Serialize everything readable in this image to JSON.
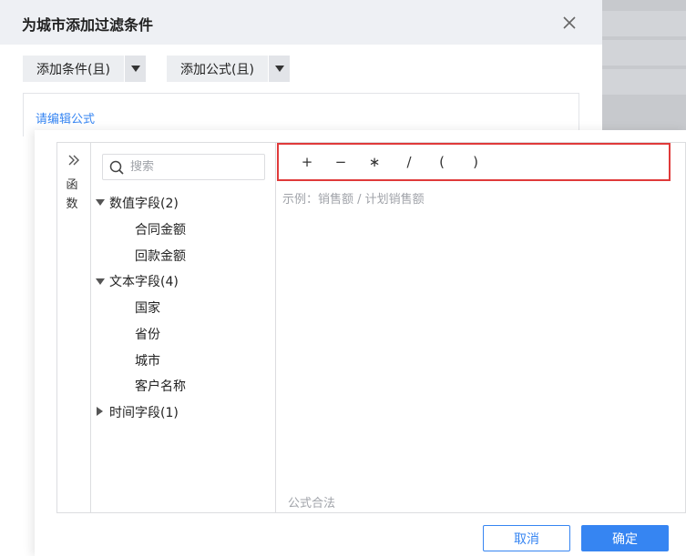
{
  "dialog": {
    "title": "为城市添加过滤条件",
    "add_condition_label": "添加条件(且)",
    "add_formula_label": "添加公式(且)",
    "formula_placeholder": "请编辑公式"
  },
  "editor": {
    "function_tab_label": "函\n数",
    "search_placeholder": "搜索",
    "tree": [
      {
        "label": "数值字段(2)",
        "expanded": true,
        "children": [
          "合同金额",
          "回款金额"
        ]
      },
      {
        "label": "文本字段(4)",
        "expanded": true,
        "children": [
          "国家",
          "省份",
          "城市",
          "客户名称"
        ]
      },
      {
        "label": "时间字段(1)",
        "expanded": false,
        "children": []
      }
    ],
    "operators": [
      "+",
      "−",
      "∗",
      "/",
      "(",
      ")"
    ],
    "example": "示例：销售额 / 计划销售额",
    "status": "公式合法"
  },
  "footer": {
    "cancel_label": "取消",
    "ok_label": "确定"
  },
  "colors": {
    "accent": "#3685f2",
    "highlight_border": "#e03a3a",
    "header_bg": "#eef0f4"
  },
  "icons": [
    "close-icon",
    "chevron-down-icon",
    "double-chevron-right-icon",
    "search-icon",
    "caret-down-icon",
    "caret-right-icon"
  ]
}
